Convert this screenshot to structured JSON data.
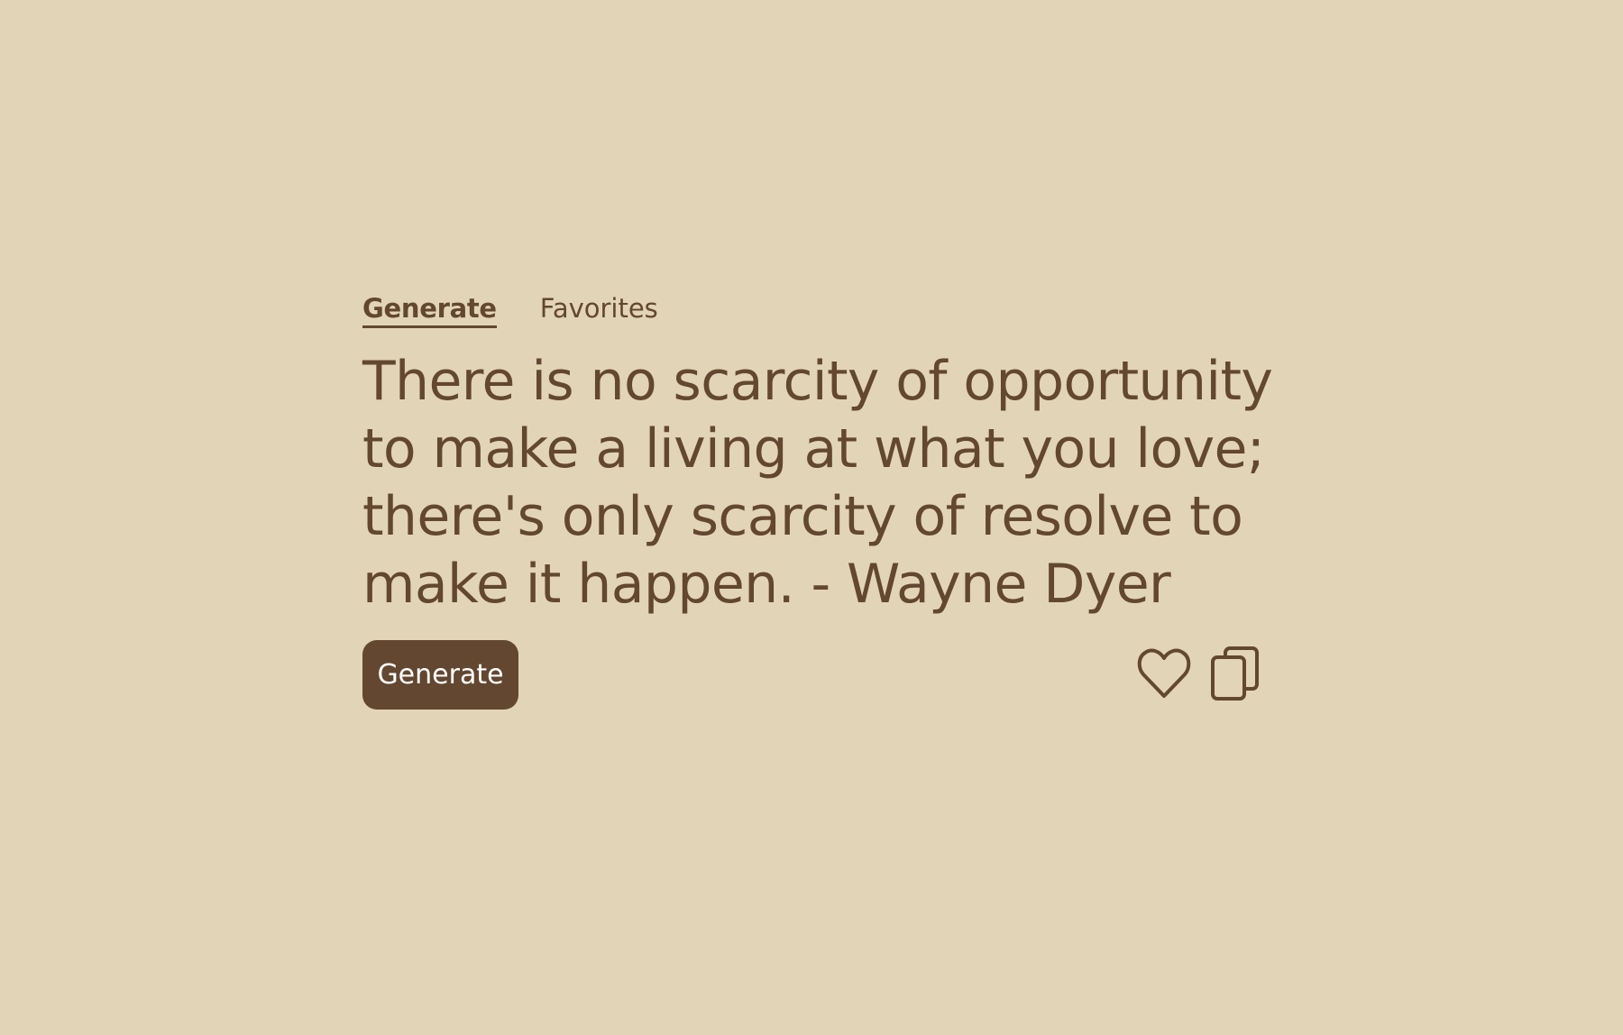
{
  "tabs": {
    "generate_label": "Generate",
    "favorites_label": "Favorites"
  },
  "quote": {
    "text": "There is no scarcity of opportunity to make a living at what you love; there's only scarcity of resolve to make it happen. - Wayne Dyer"
  },
  "actions": {
    "generate_label": "Generate",
    "favorite_icon": "heart-outline-icon",
    "copy_icon": "copy-icon"
  },
  "colors": {
    "background": "#e2d4b7",
    "primary": "#634730",
    "button_text": "#ffffff"
  }
}
